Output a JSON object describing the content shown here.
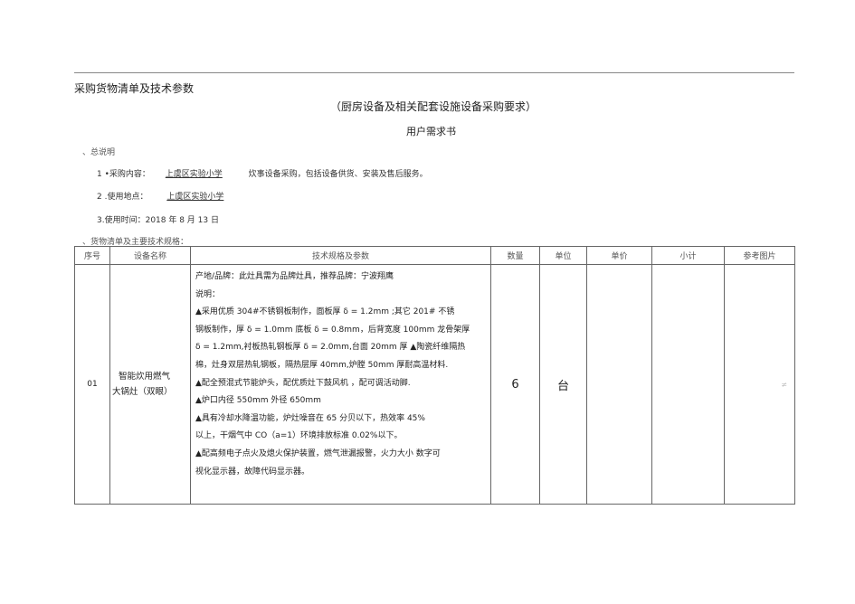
{
  "header": {
    "title": "采购货物清单及技术参数",
    "subtitle": "（厨房设备及相关配套设施设备采购要求）",
    "doc_name": "用户需求书"
  },
  "section1": {
    "heading": "、总说明",
    "items": [
      {
        "label": "1 •采购内容：",
        "value": "上虞区实验小学",
        "rest": "炊事设备采购，包括设备供货、安装及售后服务。"
      },
      {
        "label": "2 .使用地点：",
        "value": "上虞区实验小学"
      },
      {
        "label": "3.使用时间：2018 年 8 月 13 日"
      }
    ]
  },
  "section2": {
    "heading": "、货物清单及主要技术规格："
  },
  "table": {
    "headers": [
      "序号",
      "设备名称",
      "技术规格及参数",
      "数量",
      "单位",
      "单价",
      "小计",
      "参考图片"
    ],
    "rows": [
      {
        "no": "01",
        "name_line1": "智能炊用燃气",
        "name_line2": "大锅灶（双眼）",
        "spec": [
          "产地/品牌：此灶具需为品牌灶具，推荐品牌：宁波翔鹰",
          "说明：",
          "▲采用优质 304#不锈钢板制作，面板厚 δ = 1.2mm ;其它 201# 不锈",
          "钢板制作，厚 δ = 1.0mm 底板 δ = 0.8mm，后背宽度 100mm 龙骨架厚",
          "δ = 1.2mm,衬板热轧钢板厚 δ = 2.0mm,台面 20mm 厚 ▲陶瓷纤维隔热",
          "棉，灶身双层热轧钢板，隔热层厚 40mm,炉膛 50mm 厚耐高温材料.",
          "▲配全预混式节能炉头，配优质灶下鼓风机      ，配可调活动脚.",
          "▲炉口内径 550mm 外径 650mm",
          "▲具有冷却水降温功能，炉灶噪音在      65 分贝以下，热效率 45%",
          "以上，干烟气中 CO（a=1）环境排放标准 0.02%以下。",
          "▲配高频电子点火及熄火保护装置，燃气泄漏报警，火力大小   数字可",
          "视化显示器，故障代码显示器。"
        ],
        "qty": "6",
        "unit": "台",
        "price": "",
        "subtotal": "",
        "ref_mark": "≠"
      }
    ]
  }
}
